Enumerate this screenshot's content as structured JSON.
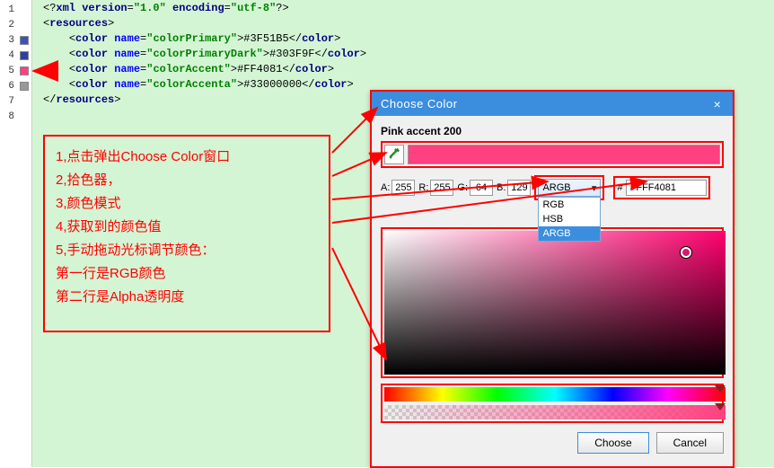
{
  "editor": {
    "lines": [
      {
        "n": 1
      },
      {
        "n": 2
      },
      {
        "n": 3,
        "swatch": "#3F51B5"
      },
      {
        "n": 4,
        "swatch": "#303F9F"
      },
      {
        "n": 5,
        "swatch": "#FF4081"
      },
      {
        "n": 6,
        "swatch": "#999999"
      },
      {
        "n": 7
      },
      {
        "n": 8
      }
    ],
    "xml": {
      "decl_version": "1.0",
      "decl_encoding": "utf-8",
      "root": "resources",
      "element": "color",
      "attr_name": "name",
      "entries": [
        {
          "name": "colorPrimary",
          "value": "#3F51B5"
        },
        {
          "name": "colorPrimaryDark",
          "value": "#303F9F"
        },
        {
          "name": "colorAccent",
          "value": "#FF4081"
        },
        {
          "name": "colorAccenta",
          "value": "#33000000"
        }
      ]
    }
  },
  "annotations": {
    "lines": [
      "1,点击弹出Choose Color窗口",
      "2,拾色器，",
      "3,颜色模式",
      "4,获取到的颜色值",
      "5,手动拖动光标调节颜色：",
      "   第一行是RGB颜色",
      "   第二行是Alpha透明度"
    ]
  },
  "dialog": {
    "title": "Choose Color",
    "close": "×",
    "color_name": "Pink accent 200",
    "a_label": "A:",
    "a_val": "255",
    "r_label": "R:",
    "r_val": "255",
    "g_label": "G:",
    "g_val": "64",
    "b_label": "B:",
    "b_val": "129",
    "mode_selected": "ARGB",
    "mode_options": [
      "RGB",
      "HSB",
      "ARGB"
    ],
    "hex": "FFFF4081",
    "hex_prefix": "#",
    "choose_btn": "Choose",
    "cancel_btn": "Cancel"
  }
}
